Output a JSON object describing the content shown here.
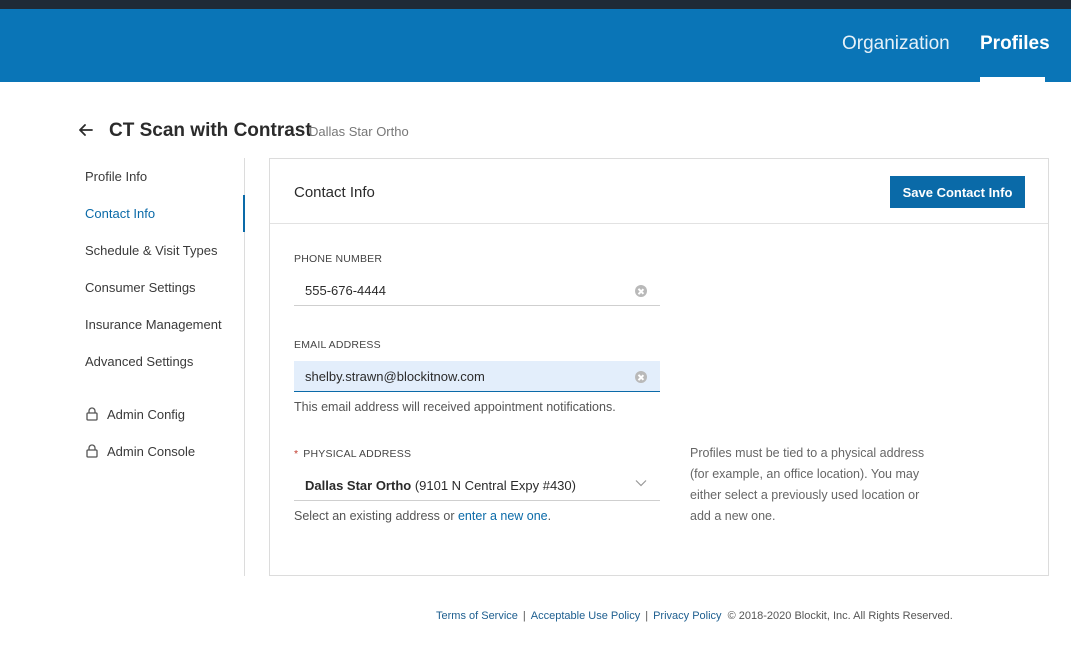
{
  "header": {
    "nav": [
      {
        "label": "Organization"
      },
      {
        "label": "Profiles"
      }
    ]
  },
  "page": {
    "title": "CT Scan with Contrast",
    "subtitle": "Dallas Star Ortho"
  },
  "sidebar": {
    "items": [
      {
        "label": "Profile Info"
      },
      {
        "label": "Contact Info"
      },
      {
        "label": "Schedule & Visit Types"
      },
      {
        "label": "Consumer Settings"
      },
      {
        "label": "Insurance Management"
      },
      {
        "label": "Advanced Settings"
      }
    ],
    "locked_items": [
      {
        "label": "Admin Config"
      },
      {
        "label": "Admin Console"
      }
    ]
  },
  "panel": {
    "title": "Contact Info",
    "save_label": "Save Contact Info",
    "phone": {
      "label": "PHONE NUMBER",
      "value": "555-676-4444"
    },
    "email": {
      "label": "EMAIL ADDRESS",
      "value": "shelby.strawn@blockitnow.com",
      "helper": "This email address will received appointment notifications."
    },
    "address": {
      "required_mark": "*",
      "label": "PHYSICAL ADDRESS",
      "selected_name": "Dallas Star Ortho",
      "selected_detail": " (9101 N Central Expy #430)",
      "helper_prefix": "Select an existing address or ",
      "helper_link": "enter a new one",
      "helper_suffix": ".",
      "note": "Profiles must be tied to a physical address (for example, an office location). You may either select a previously used location or add a new one."
    }
  },
  "footer": {
    "links": [
      "Terms of Service",
      "Acceptable Use Policy",
      "Privacy Policy"
    ],
    "separator": "|",
    "copyright": "© 2018-2020 Blockit, Inc. All Rights Reserved."
  },
  "colors": {
    "header": "#0a75b7",
    "accent": "#0a6aa8",
    "focused_field": "#e3eefb"
  }
}
